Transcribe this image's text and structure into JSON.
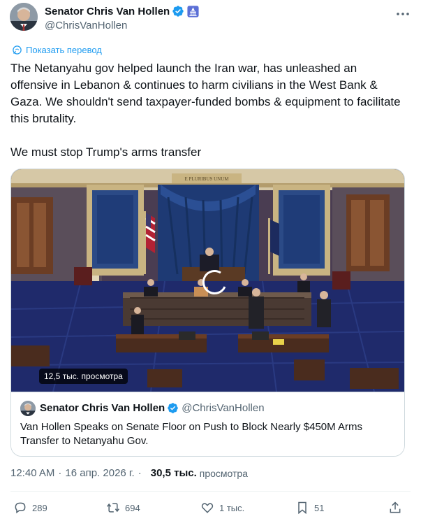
{
  "tweet": {
    "author_name": "Senator Chris Van Hollen",
    "author_handle": "@ChrisVanHollen",
    "translate_label": "Показать перевод",
    "text": "The Netanyahu gov helped launch the Iran war, has unleashed an offensive in Lebanon & continues to harm civilians in the West Bank & Gaza. We shouldn't send taxpayer-funded bombs & equipment to facilitate this brutality.\n\nWe must stop Trump's arms transfer",
    "video": {
      "views_badge": "12,5 тыс. просмотра",
      "banner_text": "E PLURIBUS UNUM"
    },
    "quote": {
      "author_name": "Senator Chris Van Hollen",
      "author_handle": "@ChrisVanHollen",
      "text": "Van Hollen Speaks on Senate Floor on Push to Block Nearly $450M Arms Transfer to Netanyahu Gov."
    },
    "time": "12:40 AM",
    "separator": "·",
    "date": "16 апр. 2026 г.",
    "views_count": "30,5 тыс.",
    "views_label": "просмотра",
    "actions": {
      "replies": "289",
      "reposts": "694",
      "likes": "1 тыс.",
      "bookmarks": "51"
    }
  },
  "colors": {
    "verified": "#1d9bf0",
    "link": "#1d9bf0",
    "secondary_text": "#536471",
    "senate_carpet": "#1f2a6b"
  },
  "icons": [
    "verified-badge-icon",
    "flag-badge-icon",
    "more-icon",
    "translate-icon",
    "reply-icon",
    "repost-icon",
    "like-icon",
    "bookmark-icon",
    "share-icon"
  ]
}
